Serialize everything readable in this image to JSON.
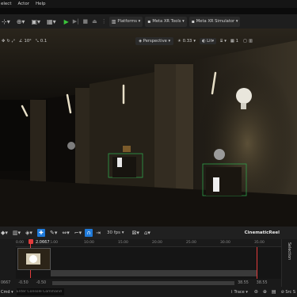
{
  "menu": [
    "elect",
    "Actor",
    "Help"
  ],
  "toolbar": {
    "platforms": "Platforms ▾",
    "meta_xr_tools": "Meta XR Tools ▾",
    "meta_xr_simulator": "Meta XR Simulator ▾"
  },
  "viewport_bar": {
    "fov": "10°",
    "speed": "0.1",
    "perspective": "Perspective",
    "exposure": "0.33",
    "lit": "Lit",
    "grid_num": "1"
  },
  "timeline": {
    "fps": "30 fps",
    "title": "CinematicReel",
    "current_time": "2.0667",
    "cur_frame": "0.0000",
    "ticks": [
      "0.00",
      "5.00",
      "10.00",
      "15.00",
      "20.00",
      "25.00",
      "30.00",
      "35.00"
    ],
    "bottom_left": "0667",
    "range_left": "-0.50",
    "range_left2": "-0.50",
    "range_right": "38.55",
    "range_right2": "38.55"
  },
  "selection_tab": "Selection",
  "statusbar": {
    "cmd_placeholder": "Enter Console Command",
    "trace": "Trace",
    "source_control": "Src S"
  },
  "colors": {
    "accent_blue": "#1f7ad9",
    "play_green": "#3bc43b",
    "playhead_red": "#e23c3c"
  }
}
